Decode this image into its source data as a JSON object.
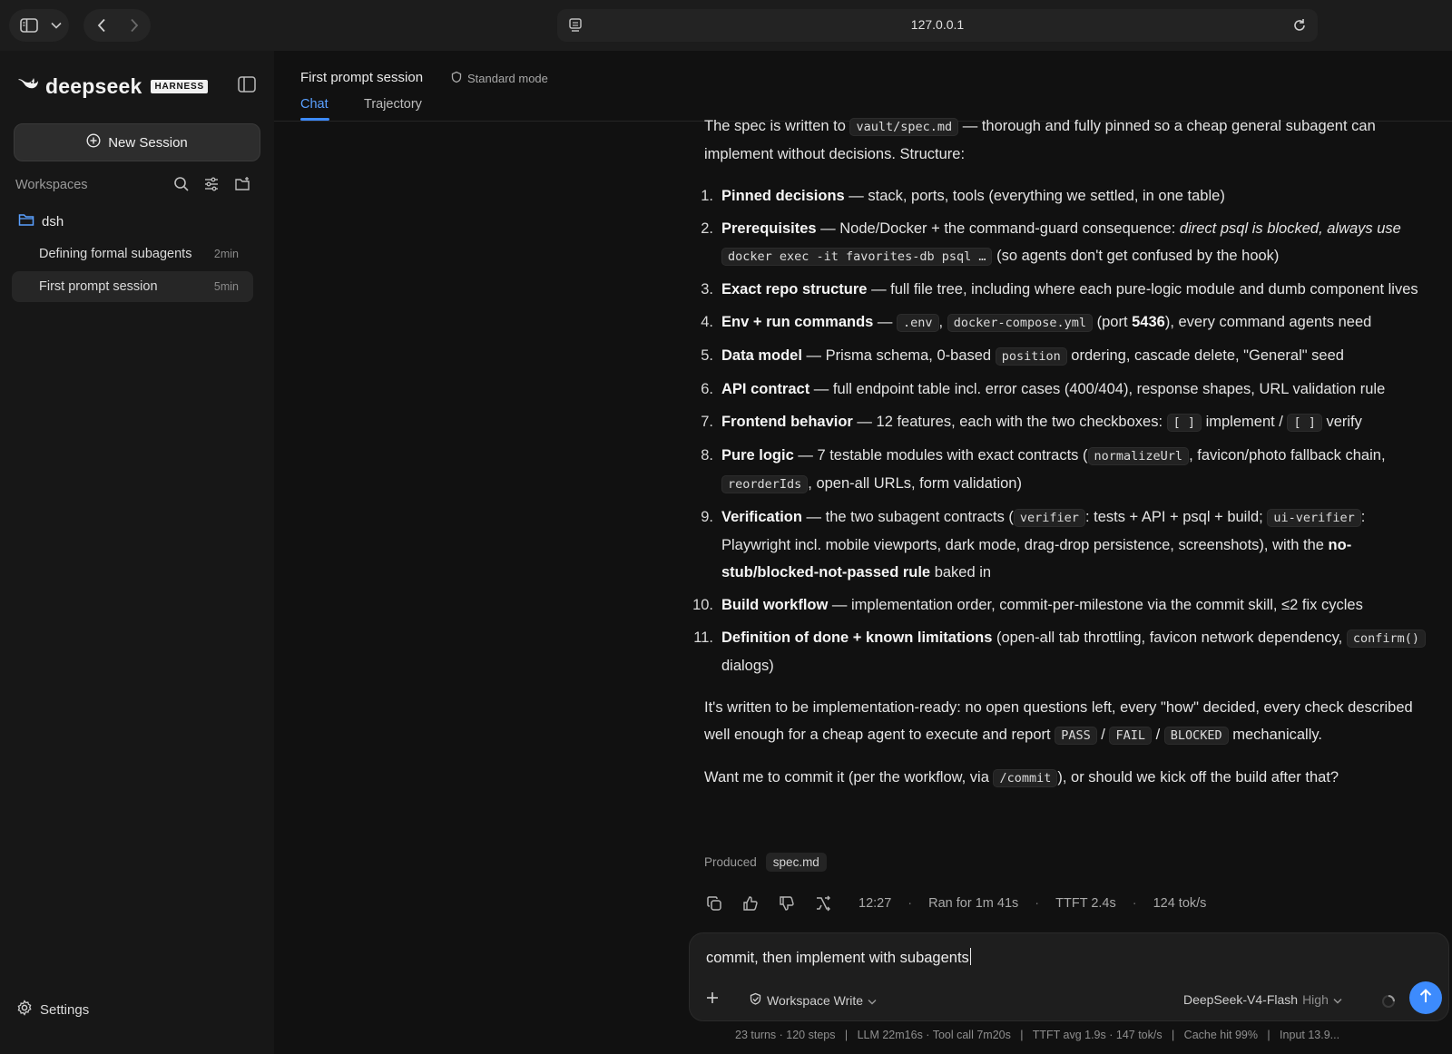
{
  "browser": {
    "url": "127.0.0.1"
  },
  "sidebar": {
    "logo_word": "deepseek",
    "logo_badge": "HARNESS",
    "new_session_label": "New Session",
    "workspaces_label": "Workspaces",
    "folder_name": "dsh",
    "sessions": [
      {
        "name": "Defining formal subagents",
        "time": "2min"
      },
      {
        "name": "First prompt session",
        "time": "5min"
      }
    ],
    "settings_label": "Settings"
  },
  "header": {
    "title": "First prompt session",
    "mode": "Standard mode",
    "tabs": [
      {
        "label": "Chat"
      },
      {
        "label": "Trajectory"
      }
    ]
  },
  "message": {
    "intro": {
      "a": "The spec is written to ",
      "code": "vault/spec.md",
      "b": " — thorough and fully pinned so a cheap general subagent can implement without decisions. Structure:"
    },
    "items": [
      {
        "num": "1.",
        "bold": "Pinned decisions",
        "text": " — stack, ports, tools (everything we settled, in one table)"
      },
      {
        "num": "2.",
        "bold": "Prerequisites",
        "t1": " — Node/Docker + the command-guard consequence: ",
        "em": "direct psql is blocked, always use ",
        "code": "docker exec -it favorites-db psql …",
        "t2": " (so agents don't get confused by the hook)"
      },
      {
        "num": "3.",
        "bold": "Exact repo structure",
        "text": " — full file tree, including where each pure-logic module and dumb component lives"
      },
      {
        "num": "4.",
        "bold": "Env + run commands",
        "t1": " — ",
        "code1": ".env",
        "t2": ", ",
        "code2": "docker-compose.yml",
        "t3": " (port ",
        "port": "5436",
        "t4": "), every command agents need"
      },
      {
        "num": "5.",
        "bold": "Data model",
        "t1": " — Prisma schema, 0-based ",
        "code": "position",
        "t2": " ordering, cascade delete, \"General\" seed"
      },
      {
        "num": "6.",
        "bold": "API contract",
        "text": " — full endpoint table incl. error cases (400/404), response shapes, URL validation rule"
      },
      {
        "num": "7.",
        "bold": "Frontend behavior",
        "t1": " — 12 features, each with the two checkboxes: ",
        "code1": "[ ]",
        "t2": " implement / ",
        "code2": "[ ]",
        "t3": " verify"
      },
      {
        "num": "8.",
        "bold": "Pure logic",
        "t1": " — 7 testable modules with exact contracts (",
        "code1": "normalizeUrl",
        "t2": ", favicon/photo fallback chain, ",
        "code2": "reorderIds",
        "t3": ", open-all URLs, form validation)"
      },
      {
        "num": "9.",
        "bold": "Verification",
        "t1": " — the two subagent contracts (",
        "code1": "verifier",
        "t2": ": tests + API + psql + build; ",
        "code2": "ui-verifier",
        "t3": ": Playwright incl. mobile viewports, dark mode, drag-drop persistence, screenshots), with the ",
        "bold2": "no-stub/blocked-not-passed rule",
        "t4": " baked in"
      },
      {
        "num": "10.",
        "bold": "Build workflow",
        "text": " — implementation order, commit-per-milestone via the commit skill, ≤2 fix cycles"
      },
      {
        "num": "11.",
        "bold": "Definition of done + known limitations",
        "t1": " (open-all tab throttling, favicon network dependency, ",
        "code": "confirm()",
        "t2": " dialogs)"
      }
    ],
    "ready": {
      "a": "It's written to be implementation-ready: no open questions left, every \"how\" decided, every check described well enough for a cheap agent to execute and report ",
      "c1": "PASS",
      "s1": " / ",
      "c2": "FAIL",
      "s2": " / ",
      "c3": "BLOCKED",
      "b": " mechanically."
    },
    "question": {
      "a": "Want me to commit it (per the workflow, via ",
      "code": "/commit",
      "b": "), or should we kick off the build after that?"
    },
    "produced_label": "Produced",
    "produced_file": "spec.md"
  },
  "meta": {
    "time": "12:27",
    "ran_for": "Ran for 1m 41s",
    "ttft": "TTFT 2.4s",
    "rate": "124 tok/s",
    "sep": "·"
  },
  "composer": {
    "value": "commit, then implement with subagents",
    "mode": "Workspace Write",
    "model": "DeepSeek-V4-Flash",
    "level": "High"
  },
  "status_line": "23 turns · 120 steps   |   LLM 22m16s · Tool call 7m20s   |   TTFT avg 1.9s · 147 tok/s   |   Cache hit 99%   |   Input 13.9...",
  "colors": {
    "accent": "#3d8bfd",
    "background": "#111111",
    "sidebar": "#171717"
  },
  "icons": [
    "sidebar-toggle-icon",
    "chevron-down-icon",
    "back-icon",
    "forward-icon",
    "page-icon",
    "reload-icon",
    "deepseek-whale-icon",
    "collapse-sidebar-icon",
    "plus-circle-icon",
    "search-icon",
    "filter-icon",
    "new-folder-icon",
    "folder-icon",
    "gear-icon",
    "copy-icon",
    "thumbs-up-icon",
    "thumbs-down-icon",
    "branch-icon",
    "plus-icon",
    "shield-icon",
    "spinner-icon",
    "arrow-up-icon"
  ]
}
